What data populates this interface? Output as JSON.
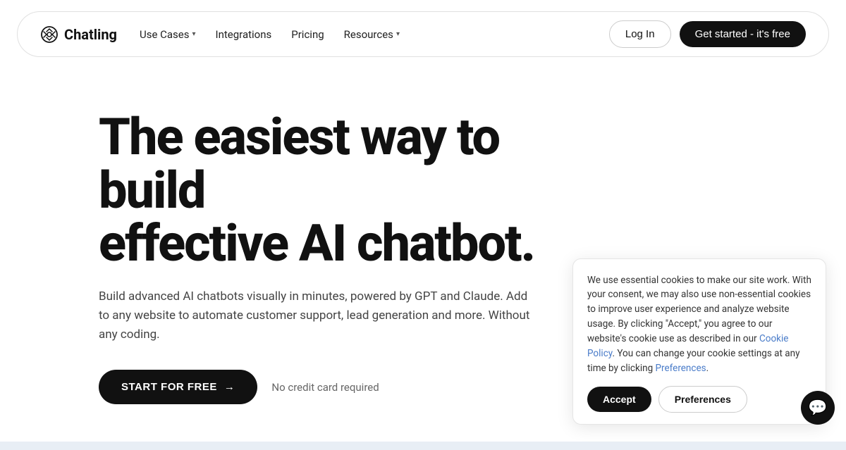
{
  "nav": {
    "logo_text": "Chatling",
    "links": [
      {
        "label": "Use Cases",
        "has_chevron": true
      },
      {
        "label": "Integrations",
        "has_chevron": false
      },
      {
        "label": "Pricing",
        "has_chevron": false
      },
      {
        "label": "Resources",
        "has_chevron": true
      }
    ],
    "login_label": "Log In",
    "cta_label": "Get started - it's free"
  },
  "hero": {
    "title_line1": "The easiest way to build",
    "title_line2": "effective AI chatbot.",
    "subtitle": "Build advanced AI chatbots visually in minutes, powered by GPT and Claude. Add to any website to automate customer support, lead generation and more. Without any coding.",
    "cta_label": "START FOR FREE",
    "cta_arrow": "→",
    "no_credit": "No credit card required"
  },
  "cookie": {
    "body": "We use essential cookies to make our site work. With your consent, we may also use non-essential cookies to improve user experience and analyze website usage. By clicking \"Accept,\" you agree to our website's cookie use as described in our ",
    "link1_label": "Cookie Policy",
    "body2": ". You can change your cookie settings at any time by clicking ",
    "link2_label": "Preferences",
    "body3": ".",
    "accept_label": "Accept",
    "preferences_label": "Preferences"
  }
}
